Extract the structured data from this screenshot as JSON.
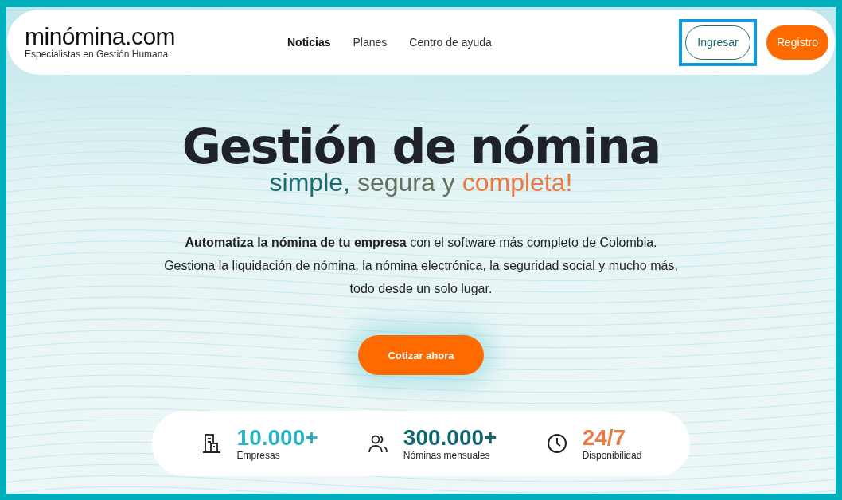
{
  "logo": {
    "name": "minómina.com",
    "tagline": "Especialistas en Gestión Humana"
  },
  "nav": [
    {
      "label": "Noticias",
      "selected": true
    },
    {
      "label": "Planes",
      "selected": false
    },
    {
      "label": "Centro de ayuda",
      "selected": false
    }
  ],
  "actions": [
    {
      "label": "Ingresar",
      "kind": "outline",
      "highlighted": true
    },
    {
      "label": "Registro",
      "kind": "filled",
      "highlighted": false
    }
  ],
  "hero": {
    "title": "Gestión de nómina",
    "subtitle": [
      {
        "text": "simple,",
        "color": "#1e6a73"
      },
      {
        "text": "segura y",
        "color": "#66705f"
      },
      {
        "text": "completa!",
        "color": "#e87a45"
      }
    ],
    "body": [
      "**Automatiza la nómina de tu empresa** con el software más completo de Colombia.",
      "Gestiona la liquidación de nómina, la nómina electrónica, la seguridad social y mucho más,",
      "todo desde un solo lugar."
    ],
    "cta": "Cotizar ahora"
  },
  "stats": [
    {
      "kind": "building",
      "value": "10.000+",
      "label": "Empresas",
      "color": "#2ab3bf"
    },
    {
      "kind": "people",
      "value": "300.000+",
      "label": "Nóminas mensuales",
      "color": "#11666e"
    },
    {
      "kind": "clock",
      "value": "24/7",
      "label": "Disponibilidad",
      "color": "#e87a45"
    }
  ]
}
